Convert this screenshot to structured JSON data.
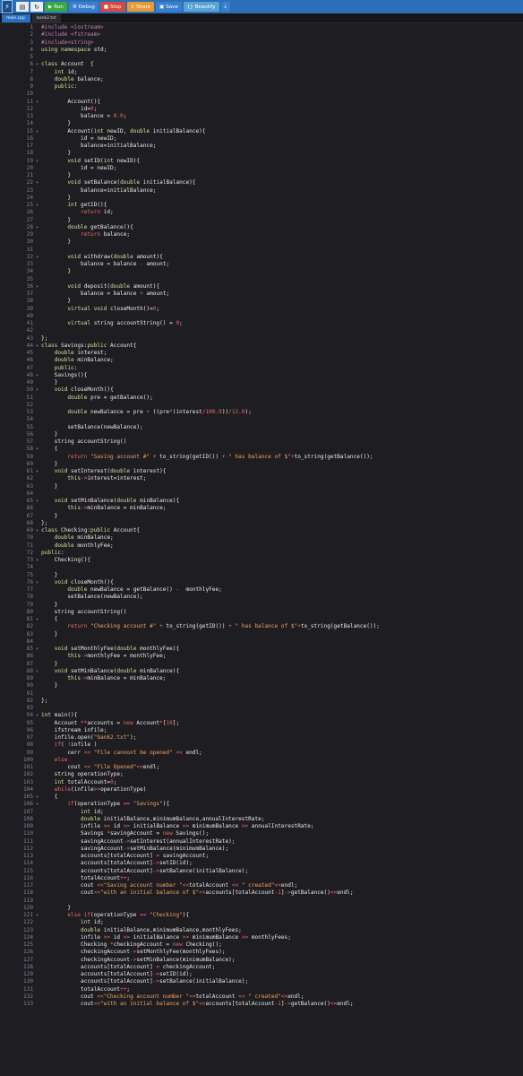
{
  "app": {
    "icon_glyph": "⚡"
  },
  "toolbar": {
    "buttons": [
      {
        "name": "new-file-button",
        "icon": "new-file-icon",
        "glyph": "▤",
        "label": "",
        "color": ""
      },
      {
        "name": "open-button",
        "icon": "open-icon",
        "glyph": "↻",
        "label": "",
        "color": ""
      },
      {
        "name": "run-button",
        "icon": "play-icon",
        "glyph": "▶",
        "label": "Run",
        "color": "#3aa845"
      },
      {
        "name": "debug-button",
        "icon": "debug-icon",
        "glyph": "⚙",
        "label": "Debug",
        "color": "#3a7ecf"
      },
      {
        "name": "stop-button",
        "icon": "stop-icon",
        "glyph": "■",
        "label": "Stop",
        "color": "#d5493f"
      },
      {
        "name": "share-button",
        "icon": "share-icon",
        "glyph": "⇪",
        "label": "Share",
        "color": "#e69a36"
      },
      {
        "name": "save-button",
        "icon": "save-icon",
        "glyph": "▣",
        "label": "Save",
        "color": "#3a7ecf"
      },
      {
        "name": "beautify-button",
        "icon": "beautify-icon",
        "glyph": "{}",
        "label": "Beautify",
        "color": "#5aa3d8"
      },
      {
        "name": "download-button",
        "icon": "download-icon",
        "glyph": "⤓",
        "label": "",
        "color": "#3a7ecf"
      }
    ]
  },
  "tabs": [
    {
      "label": "main.cpp",
      "active": true
    },
    {
      "label": "bank2.txt",
      "active": false
    }
  ],
  "code": [
    {
      "n": 1,
      "html": "<span class=\"pp\">#include &lt;iostream&gt;</span>"
    },
    {
      "n": 2,
      "html": "<span class=\"pp\">#include &lt;fstream&gt;</span>"
    },
    {
      "n": 3,
      "html": "<span class=\"pp\">#include&lt;string&gt;</span>"
    },
    {
      "n": 4,
      "html": "<span class=\"kw\">using namespace</span> std;"
    },
    {
      "n": 5,
      "html": ""
    },
    {
      "n": 6,
      "fold": true,
      "html": "<span class=\"kw\">class</span> Account  {"
    },
    {
      "n": 7,
      "html": "    <span class=\"kw\">int</span> id;"
    },
    {
      "n": 8,
      "html": "    <span class=\"kw\">double</span> balance;"
    },
    {
      "n": 9,
      "html": "    <span class=\"kw\">public</span>:"
    },
    {
      "n": 10,
      "html": ""
    },
    {
      "n": 11,
      "fold": true,
      "html": "        Account(){"
    },
    {
      "n": 12,
      "html": "            id=<span class=\"num\">0</span>;"
    },
    {
      "n": 13,
      "html": "            balance = <span class=\"num\">0.0</span>;"
    },
    {
      "n": 14,
      "html": "        }"
    },
    {
      "n": 15,
      "fold": true,
      "html": "        Account(<span class=\"kw\">int</span> newID, <span class=\"kw\">double</span> initialBalance){"
    },
    {
      "n": 16,
      "html": "            id = newID;"
    },
    {
      "n": 17,
      "html": "            balance=initialBalance;"
    },
    {
      "n": 18,
      "html": "        }"
    },
    {
      "n": 19,
      "fold": true,
      "html": "        <span class=\"kw\">void</span> setID(<span class=\"kw\">int</span> newID){"
    },
    {
      "n": 20,
      "html": "            id = newID;"
    },
    {
      "n": 21,
      "html": "        }"
    },
    {
      "n": 22,
      "fold": true,
      "html": "        <span class=\"kw\">void</span> setBalance(<span class=\"kw\">double</span> initialBalance){"
    },
    {
      "n": 23,
      "html": "            balance=initialBalance;"
    },
    {
      "n": 24,
      "html": "        }"
    },
    {
      "n": 25,
      "fold": true,
      "html": "        <span class=\"kw\">int</span> getID(){"
    },
    {
      "n": 26,
      "html": "            <span class=\"op\">return</span> id;"
    },
    {
      "n": 27,
      "html": "        }"
    },
    {
      "n": 28,
      "fold": true,
      "html": "        <span class=\"kw\">double</span> getBalance(){"
    },
    {
      "n": 29,
      "html": "            <span class=\"op\">return</span> balance;"
    },
    {
      "n": 30,
      "html": "        }"
    },
    {
      "n": 31,
      "html": ""
    },
    {
      "n": 32,
      "fold": true,
      "html": "        <span class=\"kw\">void</span> withdraw(<span class=\"kw\">double</span> amount){"
    },
    {
      "n": 33,
      "html": "            balance = balance <span class=\"op\">-</span> amount;"
    },
    {
      "n": 34,
      "html": "        }"
    },
    {
      "n": 35,
      "html": ""
    },
    {
      "n": 36,
      "fold": true,
      "html": "        <span class=\"kw\">void</span> deposit(<span class=\"kw\">double</span> amount){"
    },
    {
      "n": 37,
      "html": "            balance = balance <span class=\"op\">+</span> amount;"
    },
    {
      "n": 38,
      "html": "        }"
    },
    {
      "n": 39,
      "html": "        <span class=\"kw\">virtual void</span> closeMonth()=<span class=\"num\">0</span>;"
    },
    {
      "n": 40,
      "html": ""
    },
    {
      "n": 41,
      "html": "        <span class=\"kw\">virtual</span> string accountString() = <span class=\"num\">0</span>;"
    },
    {
      "n": 42,
      "html": ""
    },
    {
      "n": 43,
      "html": "};"
    },
    {
      "n": 44,
      "fold": true,
      "html": "<span class=\"kw\">class</span> Savings:<span class=\"kw\">public</span> Account{"
    },
    {
      "n": 45,
      "html": "    <span class=\"kw\">double</span> interest;"
    },
    {
      "n": 46,
      "html": "    <span class=\"kw\">double</span> minBalance;"
    },
    {
      "n": 47,
      "html": "    <span class=\"kw\">public</span>:"
    },
    {
      "n": 48,
      "fold": true,
      "html": "    Savings(){"
    },
    {
      "n": 49,
      "html": "    }"
    },
    {
      "n": 50,
      "fold": true,
      "html": "    <span class=\"kw\">void</span> closeMonth(){"
    },
    {
      "n": 51,
      "html": "        <span class=\"kw\">double</span> pre = getBalance();"
    },
    {
      "n": 52,
      "html": ""
    },
    {
      "n": 53,
      "html": "        <span class=\"kw\">double</span> newBalance = pre <span class=\"op\">+</span> ((pre<span class=\"op\">*</span>(interest<span class=\"op\">/</span><span class=\"num\">100.0</span>))<span class=\"op\">/</span><span class=\"num\">12.0</span>);"
    },
    {
      "n": 54,
      "html": ""
    },
    {
      "n": 55,
      "html": "        setBalance(newBalance);"
    },
    {
      "n": 56,
      "html": "    }"
    },
    {
      "n": 57,
      "html": "    string accountString()"
    },
    {
      "n": 58,
      "fold": true,
      "html": "    {"
    },
    {
      "n": 59,
      "html": "        <span class=\"op\">return</span> <span class=\"str\">\"Saving account #\"</span> <span class=\"op\">+</span> to_string(getID()) <span class=\"op\">+</span> <span class=\"str\">\" has balance of $\"</span><span class=\"op\">+</span>to_string(getBalance());"
    },
    {
      "n": 60,
      "html": "    }"
    },
    {
      "n": 61,
      "fold": true,
      "html": "    <span class=\"kw\">void</span> setInterest(<span class=\"kw\">double</span> interest){"
    },
    {
      "n": 62,
      "html": "        <span class=\"kw\">this</span><span class=\"op\">-&gt;</span>interest=interest;"
    },
    {
      "n": 63,
      "html": "    }"
    },
    {
      "n": 64,
      "html": ""
    },
    {
      "n": 65,
      "fold": true,
      "html": "    <span class=\"kw\">void</span> setMinBalance(<span class=\"kw\">double</span> minBalance){"
    },
    {
      "n": 66,
      "html": "        <span class=\"kw\">this</span><span class=\"op\">-&gt;</span>minBalance = minBalance;"
    },
    {
      "n": 67,
      "html": "    }"
    },
    {
      "n": 68,
      "html": "};"
    },
    {
      "n": 69,
      "fold": true,
      "html": "<span class=\"kw\">class</span> Checking:<span class=\"kw\">public</span> Account{"
    },
    {
      "n": 70,
      "html": "    <span class=\"kw\">double</span> minBalance;"
    },
    {
      "n": 71,
      "html": "    <span class=\"kw\">double</span> monthlyFee;"
    },
    {
      "n": 72,
      "html": "<span class=\"kw\">public</span>:"
    },
    {
      "n": 73,
      "fold": true,
      "html": "    Checking(){"
    },
    {
      "n": 74,
      "html": ""
    },
    {
      "n": 75,
      "html": "    }"
    },
    {
      "n": 76,
      "fold": true,
      "html": "    <span class=\"kw\">void</span> closeMonth(){"
    },
    {
      "n": 77,
      "html": "        <span class=\"kw\">double</span> newBalance = getBalance() <span class=\"op\">-</span>  monthlyFee;"
    },
    {
      "n": 78,
      "html": "        setBalance(newBalance);"
    },
    {
      "n": 79,
      "html": "    }"
    },
    {
      "n": 80,
      "html": "    string accountString()"
    },
    {
      "n": 81,
      "fold": true,
      "html": "    {"
    },
    {
      "n": 82,
      "html": "        <span class=\"op\">return</span> <span class=\"str\">\"Checking account #\"</span> <span class=\"op\">+</span> to_string(getID()) <span class=\"op\">+</span> <span class=\"str\">\" has balance of $\"</span><span class=\"op\">+</span>to_string(getBalance());"
    },
    {
      "n": 83,
      "html": "    }"
    },
    {
      "n": 84,
      "html": ""
    },
    {
      "n": 85,
      "fold": true,
      "html": "    <span class=\"kw\">void</span> setMonthlyFee(<span class=\"kw\">double</span> monthlyFee){"
    },
    {
      "n": 86,
      "html": "        <span class=\"kw\">this</span><span class=\"op\">-&gt;</span>monthlyFee = monthlyFee;"
    },
    {
      "n": 87,
      "html": "    }"
    },
    {
      "n": 88,
      "fold": true,
      "html": "    <span class=\"kw\">void</span> setMinBalance(<span class=\"kw\">double</span> minBalance){"
    },
    {
      "n": 89,
      "html": "        <span class=\"kw\">this</span><span class=\"op\">-&gt;</span>minBalance = minBalance;"
    },
    {
      "n": 90,
      "html": "    }"
    },
    {
      "n": 91,
      "html": ""
    },
    {
      "n": 92,
      "html": "};"
    },
    {
      "n": 93,
      "html": ""
    },
    {
      "n": 94,
      "fold": true,
      "html": "<span class=\"kw\">int</span> main(){"
    },
    {
      "n": 95,
      "html": "    Account <span class=\"op\">**</span>accounts = <span class=\"op\">new</span> Account<span class=\"op\">*</span>[<span class=\"num\">10</span>];"
    },
    {
      "n": 96,
      "html": "    ifstream infile;"
    },
    {
      "n": 97,
      "html": "    infile.open(<span class=\"str\">\"bank2.txt\"</span>);"
    },
    {
      "n": 98,
      "html": "    <span class=\"op\">if</span>( <span class=\"op\">!</span>infile )"
    },
    {
      "n": 99,
      "html": "        cerr <span class=\"op\">&lt;&lt;</span> <span class=\"str\">\"File cannont be opened\"</span> <span class=\"op\">&lt;&lt;</span> endl;"
    },
    {
      "n": 100,
      "html": "    <span class=\"op\">else</span>"
    },
    {
      "n": 101,
      "html": "        cout <span class=\"op\">&lt;&lt;</span> <span class=\"str\">\"File Opened\"</span><span class=\"op\">&lt;&lt;</span>endl;"
    },
    {
      "n": 102,
      "html": "    string operationType;"
    },
    {
      "n": 103,
      "html": "    <span class=\"kw\">int</span> totalAccount=<span class=\"num\">0</span>;"
    },
    {
      "n": 104,
      "html": "    <span class=\"op\">while</span>(infile<span class=\"op\">&gt;&gt;</span>operationType)"
    },
    {
      "n": 105,
      "fold": true,
      "html": "    {"
    },
    {
      "n": 106,
      "fold": true,
      "html": "        <span class=\"op\">if</span>(operationType <span class=\"op\">==</span> <span class=\"str\">\"Savings\"</span>){"
    },
    {
      "n": 107,
      "html": "            <span class=\"kw\">int</span> id;"
    },
    {
      "n": 108,
      "html": "            <span class=\"kw\">double</span> initialBalance,minimumBalance,annualInterestRate;"
    },
    {
      "n": 109,
      "html": "            infile <span class=\"op\">&gt;&gt;</span> id <span class=\"op\">&gt;&gt;</span> initialBalance <span class=\"op\">&gt;&gt;</span> minimumBalance <span class=\"op\">&gt;&gt;</span> annualInterestRate;"
    },
    {
      "n": 110,
      "html": "            Savings <span class=\"op\">*</span>savingAccount = <span class=\"op\">new</span> Savings();"
    },
    {
      "n": 111,
      "html": "            savingAccount<span class=\"op\">-&gt;</span>setInterest(annualInterestRate);"
    },
    {
      "n": 112,
      "html": "            savingAccount<span class=\"op\">-&gt;</span>setMinBalance(minimumBalance);"
    },
    {
      "n": 113,
      "html": "            accounts[totalAccount] <span class=\"op\">=</span> savingAccount;"
    },
    {
      "n": 114,
      "html": "            accounts[totalAccount]<span class=\"op\">-&gt;</span>setID(id);"
    },
    {
      "n": 115,
      "html": "            accounts[totalAccount]<span class=\"op\">-&gt;</span>setBalance(initialBalance);"
    },
    {
      "n": 116,
      "html": "            totalAccount<span class=\"op\">++</span>;"
    },
    {
      "n": 117,
      "html": "            cout <span class=\"op\">&lt;&lt;</span><span class=\"str\">\"Saving account number \"</span><span class=\"op\">&lt;&lt;</span>totalAccount <span class=\"op\">&lt;&lt;</span> <span class=\"str\">\" created\"</span><span class=\"op\">&lt;&lt;</span>endl;"
    },
    {
      "n": 118,
      "html": "            cout<span class=\"op\">&lt;&lt;</span><span class=\"str\">\"with an initial balance of $\"</span><span class=\"op\">&lt;&lt;</span>accounts[totalAccount<span class=\"op\">-</span><span class=\"num\">1</span>]<span class=\"op\">-&gt;</span>getBalance()<span class=\"op\">&lt;&lt;</span>endl;"
    },
    {
      "n": 119,
      "html": ""
    },
    {
      "n": 120,
      "html": "        }"
    },
    {
      "n": 121,
      "fold": true,
      "html": "        <span class=\"op\">else if</span>(operationType <span class=\"op\">==</span> <span class=\"str\">\"Checking\"</span>){"
    },
    {
      "n": 122,
      "html": "            <span class=\"kw\">int</span> id;"
    },
    {
      "n": 123,
      "html": "            <span class=\"kw\">double</span> initialBalance,minimumBalance,monthlyFees;"
    },
    {
      "n": 124,
      "html": "            infile <span class=\"op\">&gt;&gt;</span> id <span class=\"op\">&gt;&gt;</span> initialBalance <span class=\"op\">&gt;&gt;</span> minimumBalance <span class=\"op\">&gt;&gt;</span> monthlyFees;"
    },
    {
      "n": 125,
      "html": "            Checking <span class=\"op\">*</span>checkingAccount = <span class=\"op\">new</span> Checking();"
    },
    {
      "n": 126,
      "html": "            checkingAccount<span class=\"op\">-&gt;</span>setMonthlyFee(monthlyFees);"
    },
    {
      "n": 127,
      "html": "            checkingAccount<span class=\"op\">-&gt;</span>setMinBalance(minimumBalance);"
    },
    {
      "n": 128,
      "html": "            accounts[totalAccount] <span class=\"op\">=</span> checkingAccount;"
    },
    {
      "n": 129,
      "html": "            accounts[totalAccount]<span class=\"op\">-&gt;</span>setID(id);"
    },
    {
      "n": 130,
      "html": "            accounts[totalAccount]<span class=\"op\">-&gt;</span>setBalance(initialBalance);"
    },
    {
      "n": 131,
      "html": "            totalAccount<span class=\"op\">++</span>;"
    },
    {
      "n": 132,
      "html": "            cout <span class=\"op\">&lt;&lt;</span><span class=\"str\">\"Checking account number \"</span><span class=\"op\">&lt;&lt;</span>totalAccount <span class=\"op\">&lt;&lt;</span> <span class=\"str\">\" created\"</span><span class=\"op\">&lt;&lt;</span>endl;"
    },
    {
      "n": 133,
      "html": "            cout<span class=\"op\">&lt;&lt;</span><span class=\"str\">\"with an initial balance of $\"</span><span class=\"op\">&lt;&lt;</span>accounts[totalAccount<span class=\"op\">-</span><span class=\"num\">1</span>]<span class=\"op\">-&gt;</span>getBalance()<span class=\"op\">&lt;&lt;</span>endl;"
    }
  ]
}
